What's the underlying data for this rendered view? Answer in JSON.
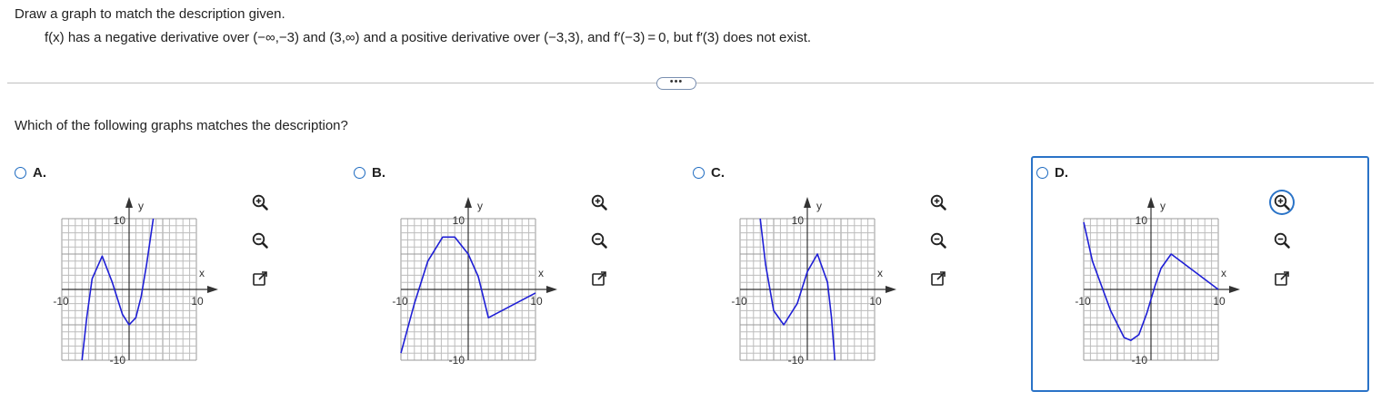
{
  "problem": {
    "instruction": "Draw a graph to match the description given.",
    "description": "f(x) has a negative derivative over (−∞,−3) and (3,∞) and a positive derivative over (−3,3), and f′(−3) = 0, but f′(3) does not exist."
  },
  "more_button_label": "•••",
  "question": "Which of the following graphs matches the description?",
  "options": [
    {
      "label": "A.",
      "selected": false,
      "curve": [
        [
          -7,
          -10
        ],
        [
          -6.3,
          -4
        ],
        [
          -5.5,
          1.5
        ],
        [
          -4,
          4.7
        ],
        [
          -2.5,
          1
        ],
        [
          -1,
          -3.5
        ],
        [
          0,
          -5
        ],
        [
          1,
          -4
        ],
        [
          1.8,
          -1
        ],
        [
          2.6,
          3.5
        ],
        [
          3.6,
          10
        ]
      ]
    },
    {
      "label": "B.",
      "selected": false,
      "curve": [
        [
          -10,
          -9
        ],
        [
          -8,
          -2
        ],
        [
          -6,
          4
        ],
        [
          -3.8,
          7.4
        ],
        [
          -2,
          7.4
        ],
        [
          0,
          5
        ],
        [
          1.5,
          1.8
        ],
        [
          3,
          -4
        ],
        [
          10,
          -0.5
        ]
      ]
    },
    {
      "label": "C.",
      "selected": false,
      "curve": [
        [
          -7,
          10
        ],
        [
          -6.2,
          3.5
        ],
        [
          -5,
          -3
        ],
        [
          -3.5,
          -5
        ],
        [
          -1.5,
          -2
        ],
        [
          0,
          2.5
        ],
        [
          1.5,
          5
        ],
        [
          3,
          1
        ],
        [
          3.6,
          -4
        ],
        [
          4.1,
          -10
        ]
      ]
    },
    {
      "label": "D.",
      "selected": true,
      "curve": [
        [
          -10,
          9.5
        ],
        [
          -8.7,
          4
        ],
        [
          -6,
          -3
        ],
        [
          -4,
          -6.8
        ],
        [
          -3,
          -7.2
        ],
        [
          -1.8,
          -6.4
        ],
        [
          -0.6,
          -3.3
        ],
        [
          0.6,
          0.5
        ],
        [
          1.5,
          3
        ],
        [
          3,
          5
        ],
        [
          10,
          0
        ]
      ]
    }
  ],
  "graph": {
    "x_label": "x",
    "y_label": "y",
    "tick_neg": "-10",
    "tick_pos": "10",
    "x_min": -10,
    "x_max": 10,
    "y_min": -10,
    "y_max": 10
  },
  "tools": [
    "zoom-in",
    "zoom-out",
    "open-new-window"
  ]
}
